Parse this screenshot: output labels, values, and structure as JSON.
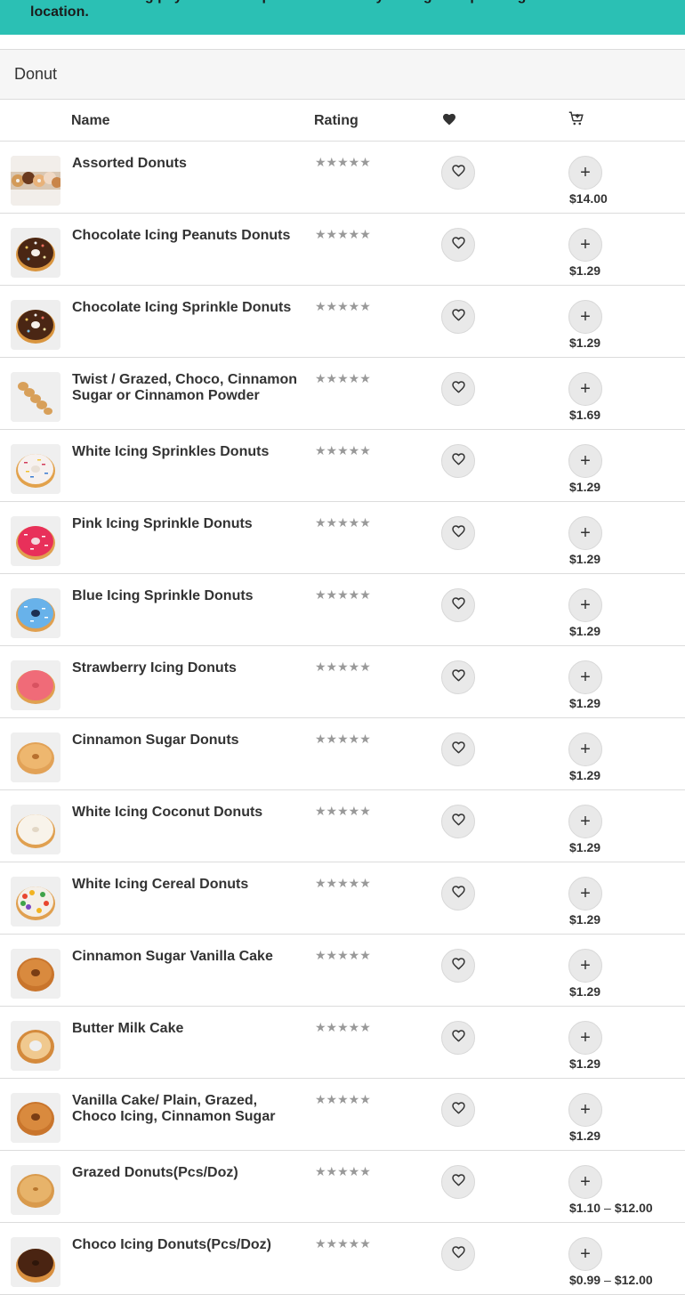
{
  "banner": {
    "text": "time when making payment. Pickup is available only during the operating hours of each location."
  },
  "section": {
    "title": "Donut"
  },
  "table": {
    "headers": {
      "name": "Name",
      "rating": "Rating",
      "favorite_icon": "heart-icon",
      "cart_icon": "cart-plus-icon"
    },
    "rows": [
      {
        "name": "Assorted Donuts",
        "stars": "★★★★★",
        "price": "$14.00",
        "price_max": "",
        "thumb": "assorted"
      },
      {
        "name": "Chocolate Icing Peanuts Donuts",
        "stars": "★★★★★",
        "price": "$1.29",
        "price_max": "",
        "thumb": "chocolate"
      },
      {
        "name": "Chocolate Icing Sprinkle Donuts",
        "stars": "★★★★★",
        "price": "$1.29",
        "price_max": "",
        "thumb": "chocolate"
      },
      {
        "name": "Twist / Grazed, Choco, Cinnamon Sugar or Cinnamon Powder",
        "stars": "★★★★★",
        "price": "$1.69",
        "price_max": "",
        "thumb": "twist"
      },
      {
        "name": "White Icing Sprinkles Donuts",
        "stars": "★★★★★",
        "price": "$1.29",
        "price_max": "",
        "thumb": "white-sprinkle"
      },
      {
        "name": "Pink Icing Sprinkle Donuts",
        "stars": "★★★★★",
        "price": "$1.29",
        "price_max": "",
        "thumb": "pink"
      },
      {
        "name": "Blue Icing Sprinkle Donuts",
        "stars": "★★★★★",
        "price": "$1.29",
        "price_max": "",
        "thumb": "blue"
      },
      {
        "name": "Strawberry Icing Donuts",
        "stars": "★★★★★",
        "price": "$1.29",
        "price_max": "",
        "thumb": "strawberry"
      },
      {
        "name": "Cinnamon Sugar Donuts",
        "stars": "★★★★★",
        "price": "$1.29",
        "price_max": "",
        "thumb": "cinnamon"
      },
      {
        "name": "White Icing Coconut Donuts",
        "stars": "★★★★★",
        "price": "$1.29",
        "price_max": "",
        "thumb": "coconut"
      },
      {
        "name": "White Icing Cereal Donuts",
        "stars": "★★★★★",
        "price": "$1.29",
        "price_max": "",
        "thumb": "cereal"
      },
      {
        "name": "Cinnamon Sugar Vanilla Cake",
        "stars": "★★★★★",
        "price": "$1.29",
        "price_max": "",
        "thumb": "cake"
      },
      {
        "name": "Butter Milk Cake",
        "stars": "★★★★★",
        "price": "$1.29",
        "price_max": "",
        "thumb": "buttermilk"
      },
      {
        "name": "Vanilla Cake/ Plain, Grazed, Choco Icing, Cinnamon Sugar",
        "stars": "★★★★★",
        "price": "$1.29",
        "price_max": "",
        "thumb": "cake"
      },
      {
        "name": "Grazed Donuts(Pcs/Doz)",
        "stars": "★★★★★",
        "price": "$1.10",
        "price_max": "$12.00",
        "thumb": "glazed"
      },
      {
        "name": "Choco Icing Donuts(Pcs/Doz)",
        "stars": "★★★★★",
        "price": "$0.99",
        "price_max": "$12.00",
        "thumb": "choco-icing"
      }
    ]
  },
  "colors": {
    "banner_bg": "#2bc0b4",
    "section_bg": "#f6f6f6",
    "button_bg": "#e9e9e9",
    "star": "#999999"
  }
}
